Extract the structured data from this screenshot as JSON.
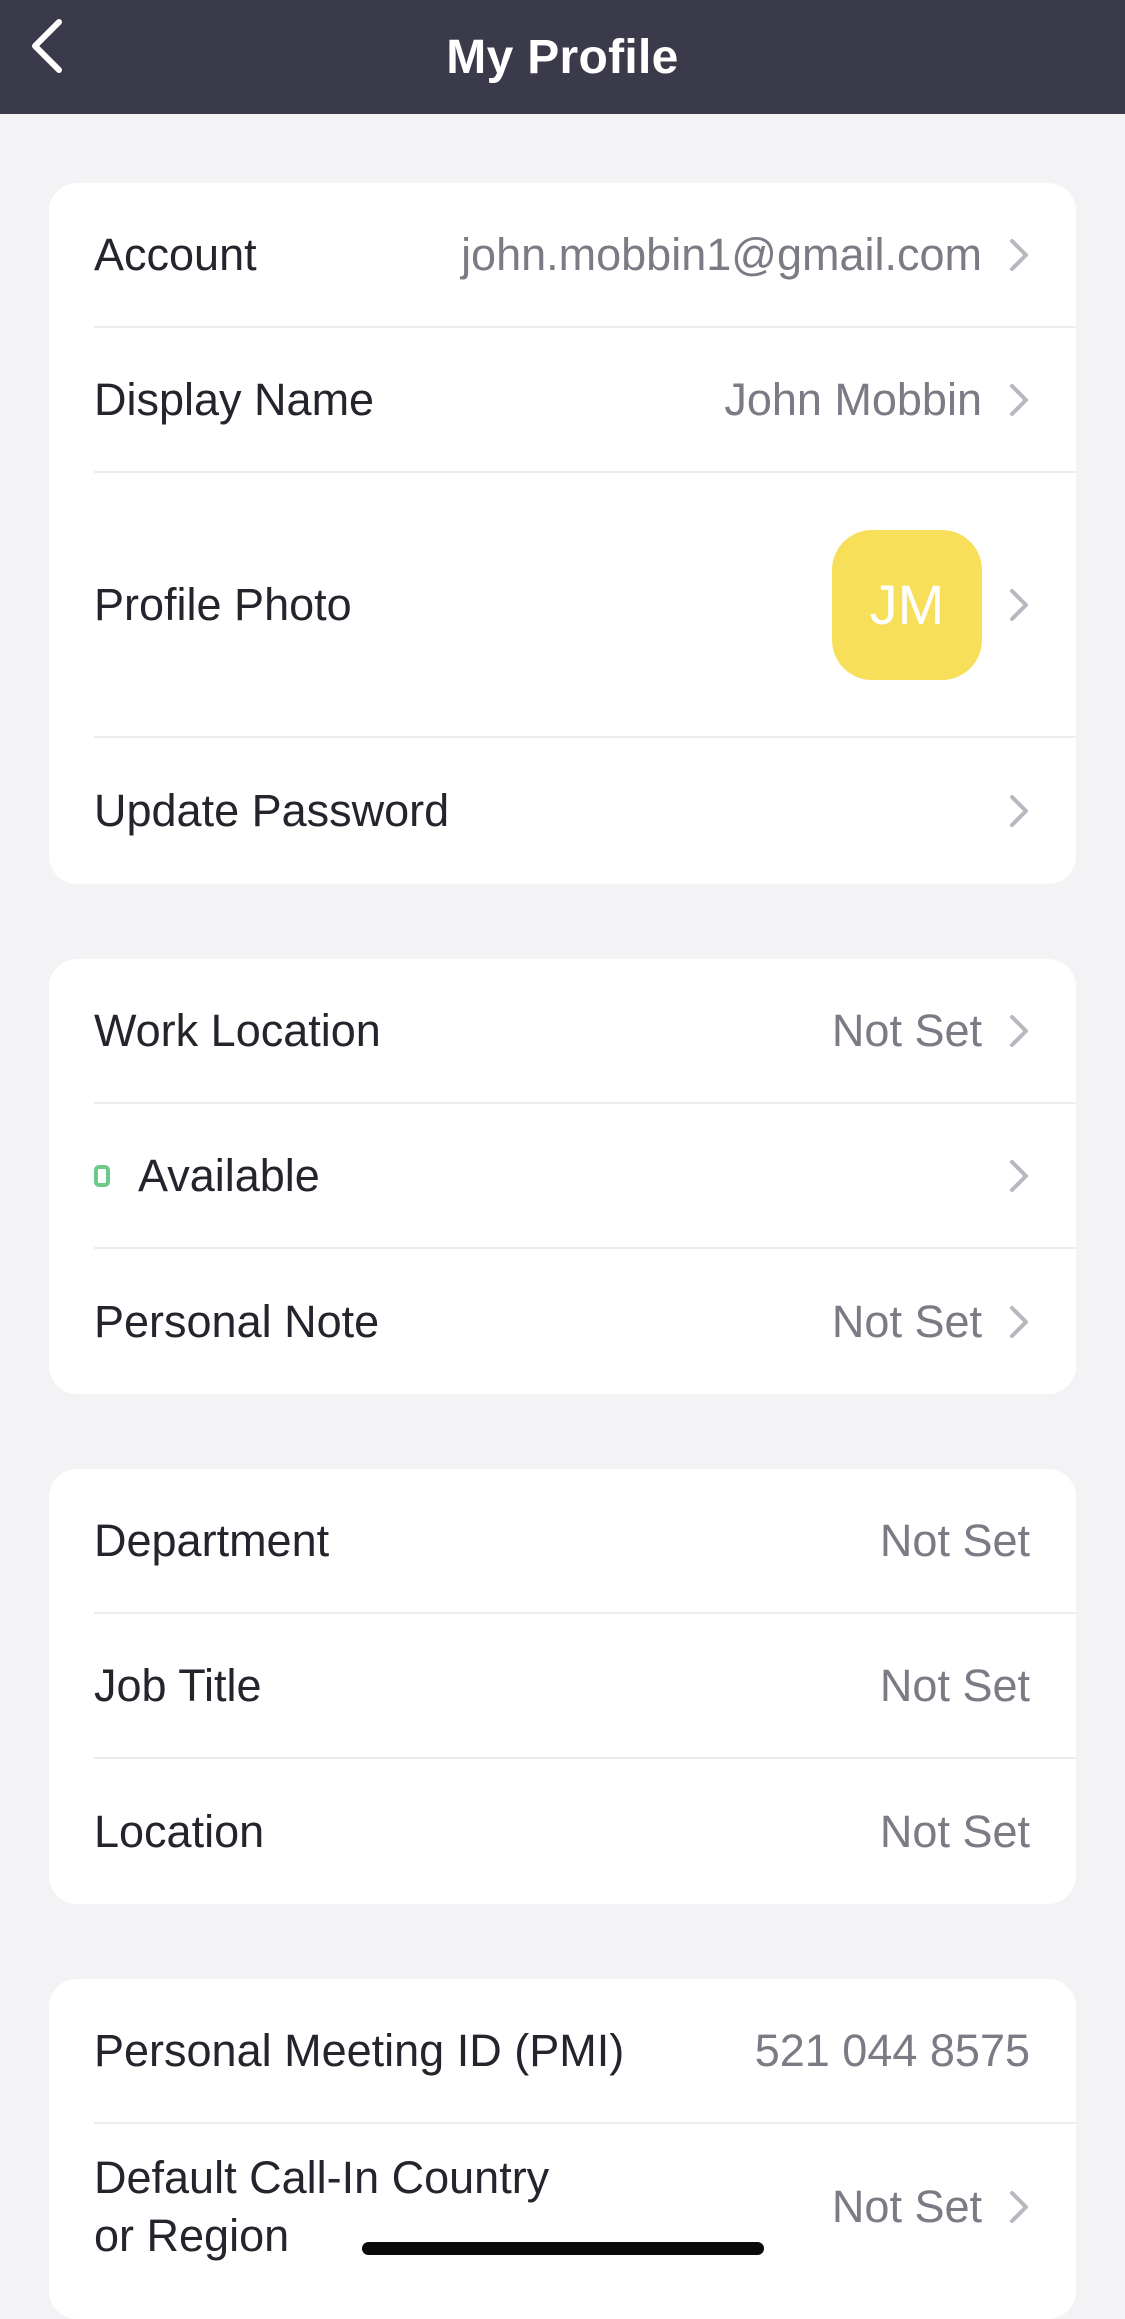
{
  "header": {
    "title": "My Profile",
    "back_icon": "chevron-left-icon"
  },
  "account_section": {
    "account_label": "Account",
    "account_value": "john.mobbin1@gmail.com",
    "display_name_label": "Display Name",
    "display_name_value": "John Mobbin",
    "profile_photo_label": "Profile Photo",
    "avatar_initials": "JM",
    "avatar_color": "#f7df5a",
    "update_password_label": "Update Password"
  },
  "status_section": {
    "work_location_label": "Work Location",
    "work_location_value": "Not Set",
    "status_label": "Available",
    "status_color": "#6cc989",
    "personal_note_label": "Personal Note",
    "personal_note_value": "Not Set"
  },
  "org_section": {
    "department_label": "Department",
    "department_value": "Not Set",
    "job_title_label": "Job Title",
    "job_title_value": "Not Set",
    "location_label": "Location",
    "location_value": "Not Set"
  },
  "meeting_section": {
    "pmi_label": "Personal Meeting ID (PMI)",
    "pmi_value": "521 044 8575",
    "call_in_label_line1": "Default Call-In Country",
    "call_in_label_line2": "or Region",
    "call_in_value": "Not Set"
  },
  "colors": {
    "header_bg": "#3b3a4a",
    "page_bg": "#f3f3f6",
    "card_bg": "#ffffff",
    "chevron": "#b7b7bf"
  }
}
